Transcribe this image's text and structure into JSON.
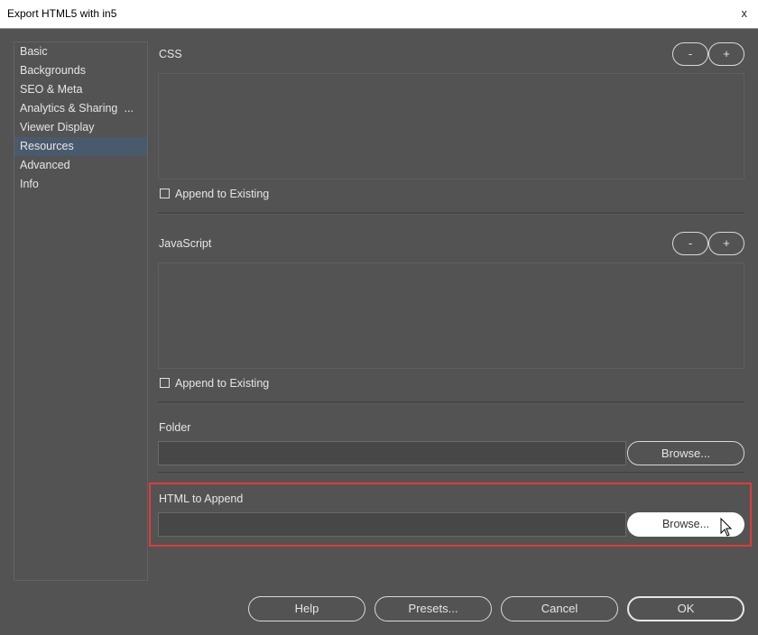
{
  "window": {
    "title": "Export HTML5 with in5",
    "close_glyph": "x"
  },
  "sidebar": {
    "items": [
      {
        "label": "Basic"
      },
      {
        "label": "Backgrounds"
      },
      {
        "label": "SEO & Meta"
      },
      {
        "label": "Analytics & Sharing",
        "more": "..."
      },
      {
        "label": "Viewer Display"
      },
      {
        "label": "Resources",
        "active": true
      },
      {
        "label": "Advanced"
      },
      {
        "label": "Info"
      }
    ]
  },
  "css": {
    "label": "CSS",
    "minus": "-",
    "plus": "+",
    "append_label": "Append to Existing",
    "append_checked": false
  },
  "javascript": {
    "label": "JavaScript",
    "minus": "-",
    "plus": "+",
    "append_label": "Append to Existing",
    "append_checked": false
  },
  "folder": {
    "label": "Folder",
    "value": "",
    "browse_label": "Browse..."
  },
  "html_append": {
    "label": "HTML to Append",
    "value": "",
    "browse_label": "Browse..."
  },
  "footer": {
    "help": "Help",
    "presets": "Presets...",
    "cancel": "Cancel",
    "ok": "OK"
  },
  "colors": {
    "background": "#535353",
    "highlight_border": "#e33a3a",
    "active_nav": "#4a5a6d"
  }
}
